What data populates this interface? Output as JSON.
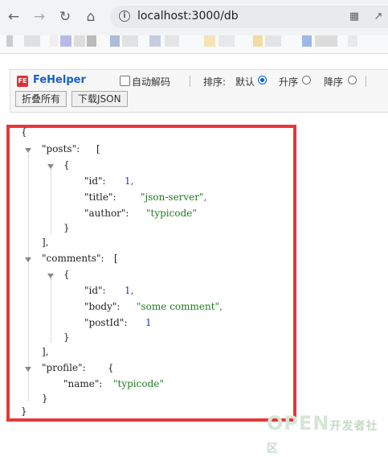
{
  "browser": {
    "url": "localhost:3000/db"
  },
  "fehelper": {
    "name": "FeHelper",
    "logo": "FE",
    "auto_decode_label": "自动解码",
    "sort_label": "排序:",
    "sort_default": "默认",
    "sort_asc": "升序",
    "sort_desc": "降序",
    "collapse_all": "折叠所有",
    "download_json": "下载JSON"
  },
  "json_view": {
    "open_brace": "{",
    "close_brace": "}",
    "posts_key": "\"posts\":",
    "posts_open": "[",
    "posts_item_open": "{",
    "posts_id_key": "\"id\":",
    "posts_id_val": "1,",
    "posts_title_key": "\"title\":",
    "posts_title_val": "\"json-server\",",
    "posts_author_key": "\"author\":",
    "posts_author_val": "\"typicode\"",
    "posts_item_close": "}",
    "posts_close": "],",
    "comments_key": "\"comments\":",
    "comments_open": "[",
    "comments_item_open": "{",
    "comments_id_key": "\"id\":",
    "comments_id_val": "1,",
    "comments_body_key": "\"body\":",
    "comments_body_val": "\"some comment\",",
    "comments_postid_key": "\"postId\":",
    "comments_postid_val": "1",
    "comments_item_close": "}",
    "comments_close": "],",
    "profile_key": "\"profile\":",
    "profile_open": "{",
    "profile_name_key": "\"name\":",
    "profile_name_val": "\"typicode\"",
    "profile_close": "}"
  },
  "watermark": {
    "main": "OPEN",
    "sub": "开发者社区"
  },
  "colors": {
    "highlight_box": "#e63838",
    "string_value": "#1f7a1f",
    "number_value": "#1c39c4",
    "fehelper_brand": "#1a5fc4"
  }
}
